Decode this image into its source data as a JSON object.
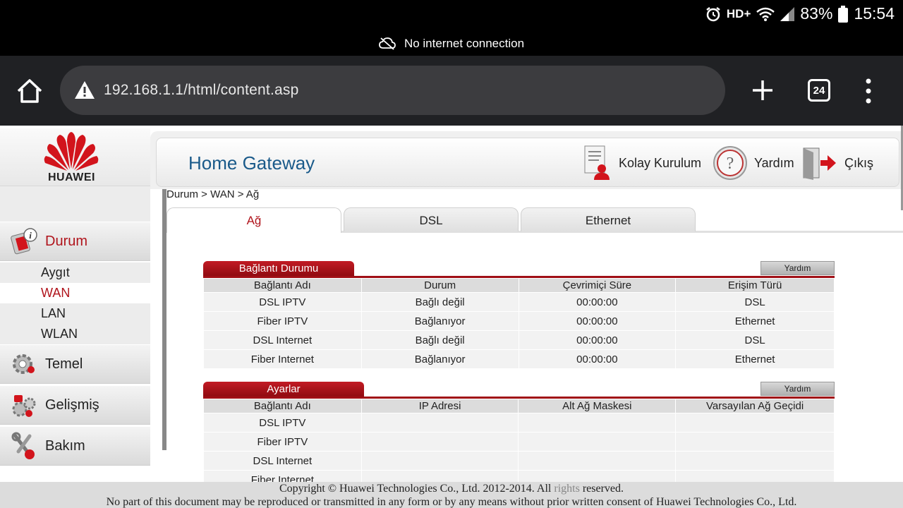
{
  "status_bar": {
    "hd_label": "HD+",
    "battery": "83%",
    "time": "15:54"
  },
  "connection_notice": "No internet connection",
  "browser": {
    "url": "192.168.1.1/html/content.asp",
    "tab_count": "24"
  },
  "brand": {
    "logo_text": "HUAWEI",
    "red": "#d2141c"
  },
  "sidebar": {
    "items": [
      {
        "label": "Durum",
        "active": true
      },
      {
        "label": "Temel"
      },
      {
        "label": "Gelişmiş"
      },
      {
        "label": "Bakım"
      }
    ],
    "sub_items": [
      {
        "label": "Aygıt"
      },
      {
        "label": "WAN",
        "active": true
      },
      {
        "label": "LAN"
      },
      {
        "label": "WLAN"
      }
    ]
  },
  "header": {
    "title": "Home Gateway",
    "links": {
      "quick_setup": "Kolay Kurulum",
      "help": "Yardım",
      "logout": "Çıkış"
    }
  },
  "breadcrumb": "Durum > WAN > Ağ",
  "tabs": [
    "Ağ",
    "DSL",
    "Ethernet"
  ],
  "connection_status": {
    "title": "Bağlantı Durumu",
    "help_label": "Yardım",
    "columns": [
      "Bağlantı Adı",
      "Durum",
      "Çevrimiçi Süre",
      "Erişim Türü"
    ],
    "rows": [
      [
        "DSL IPTV",
        "Bağlı değil",
        "00:00:00",
        "DSL"
      ],
      [
        "Fiber IPTV",
        "Bağlanıyor",
        "00:00:00",
        "Ethernet"
      ],
      [
        "DSL Internet",
        "Bağlı değil",
        "00:00:00",
        "DSL"
      ],
      [
        "Fiber Internet",
        "Bağlanıyor",
        "00:00:00",
        "Ethernet"
      ]
    ]
  },
  "settings": {
    "title": "Ayarlar",
    "help_label": "Yardım",
    "columns": [
      "Bağlantı Adı",
      "IP Adresi",
      "Alt Ağ Maskesi",
      "Varsayılan Ağ Geçidi"
    ],
    "rows": [
      [
        "DSL IPTV",
        "",
        "",
        ""
      ],
      [
        "Fiber IPTV",
        "",
        "",
        ""
      ],
      [
        "DSL Internet",
        "",
        "",
        ""
      ],
      [
        "Fiber Internet",
        "",
        "",
        ""
      ]
    ]
  },
  "footer": {
    "copyright_pre": "Copyright © Huawei Technologies Co., Ltd. 2012-2014. All",
    "copyright_rights": "rights",
    "copyright_post": "reserved.",
    "notice": "No part of this document may be reproduced or transmitted in any form or by any means without prior written consent of Huawei Technologies Co., Ltd."
  }
}
